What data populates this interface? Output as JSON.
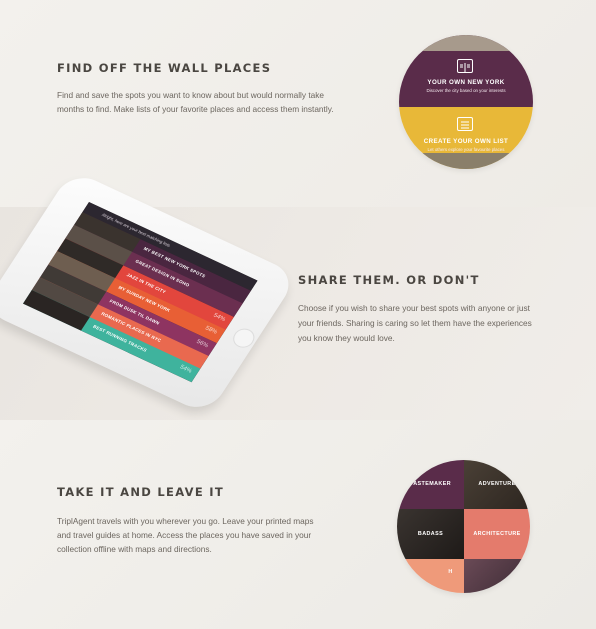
{
  "section1": {
    "heading": "FIND OFF THE WALL PLACES",
    "line1": "Find and save the spots you want to know about but would normally take",
    "line2": "months to find. Make lists of your favorite places and access them instantly.",
    "card_top": {
      "title": "YOUR OWN NEW YORK",
      "subtitle": "Discover the city based on your interests",
      "icon": "book-icon"
    },
    "card_bottom": {
      "title": "CREATE YOUR OWN LIST",
      "subtitle": "Let others explore your favourite places",
      "icon": "list-icon"
    }
  },
  "section2": {
    "heading": "SHARE THEM. OR DON'T",
    "line1": "Choose if you wish to share your best spots with anyone or just",
    "line2": "your friends. Sharing is caring so let them have the experiences",
    "line3": "you know they would love.",
    "phone": {
      "header": "Alright, here are your best matching lists",
      "rows": [
        {
          "label": "MY BEST NEW YORK SPOTS",
          "pct": "",
          "color": "#4a2640"
        },
        {
          "label": "GREAT DESIGN IN SOHO",
          "pct": "",
          "color": "#6b2f50"
        },
        {
          "label": "JAZZ IN THE CITY",
          "pct": "54%",
          "color": "#e2463d"
        },
        {
          "label": "MY SUNDAY NEW YORK",
          "pct": "58%",
          "color": "#e85f35"
        },
        {
          "label": "FROM DUSK TIL DAWN",
          "pct": "56%",
          "color": "#8e3461"
        },
        {
          "label": "ROMANTIC PLACES IN NYC",
          "pct": "",
          "color": "#e9694f"
        },
        {
          "label": "BEST RUNNING TRACKS",
          "pct": "54%",
          "color": "#3fb39d"
        }
      ]
    }
  },
  "section3": {
    "heading": "TAKE IT AND LEAVE IT",
    "line1": "TriplAgent travels with you wherever you go. Leave your printed maps",
    "line2": "and travel guides at home. Access the places you have saved in your",
    "line3": "collection offline with maps and directions.",
    "tiles": {
      "tastemaker": "TASTEMAKER",
      "adventure": "ADVENTURE",
      "badass": "BADASS",
      "architecture": "ARCHITECTURE",
      "bottom": "H"
    }
  },
  "colors": {
    "purple": "#5a2c4a",
    "yellow": "#e8b838",
    "salmon": "#e47b6c"
  }
}
